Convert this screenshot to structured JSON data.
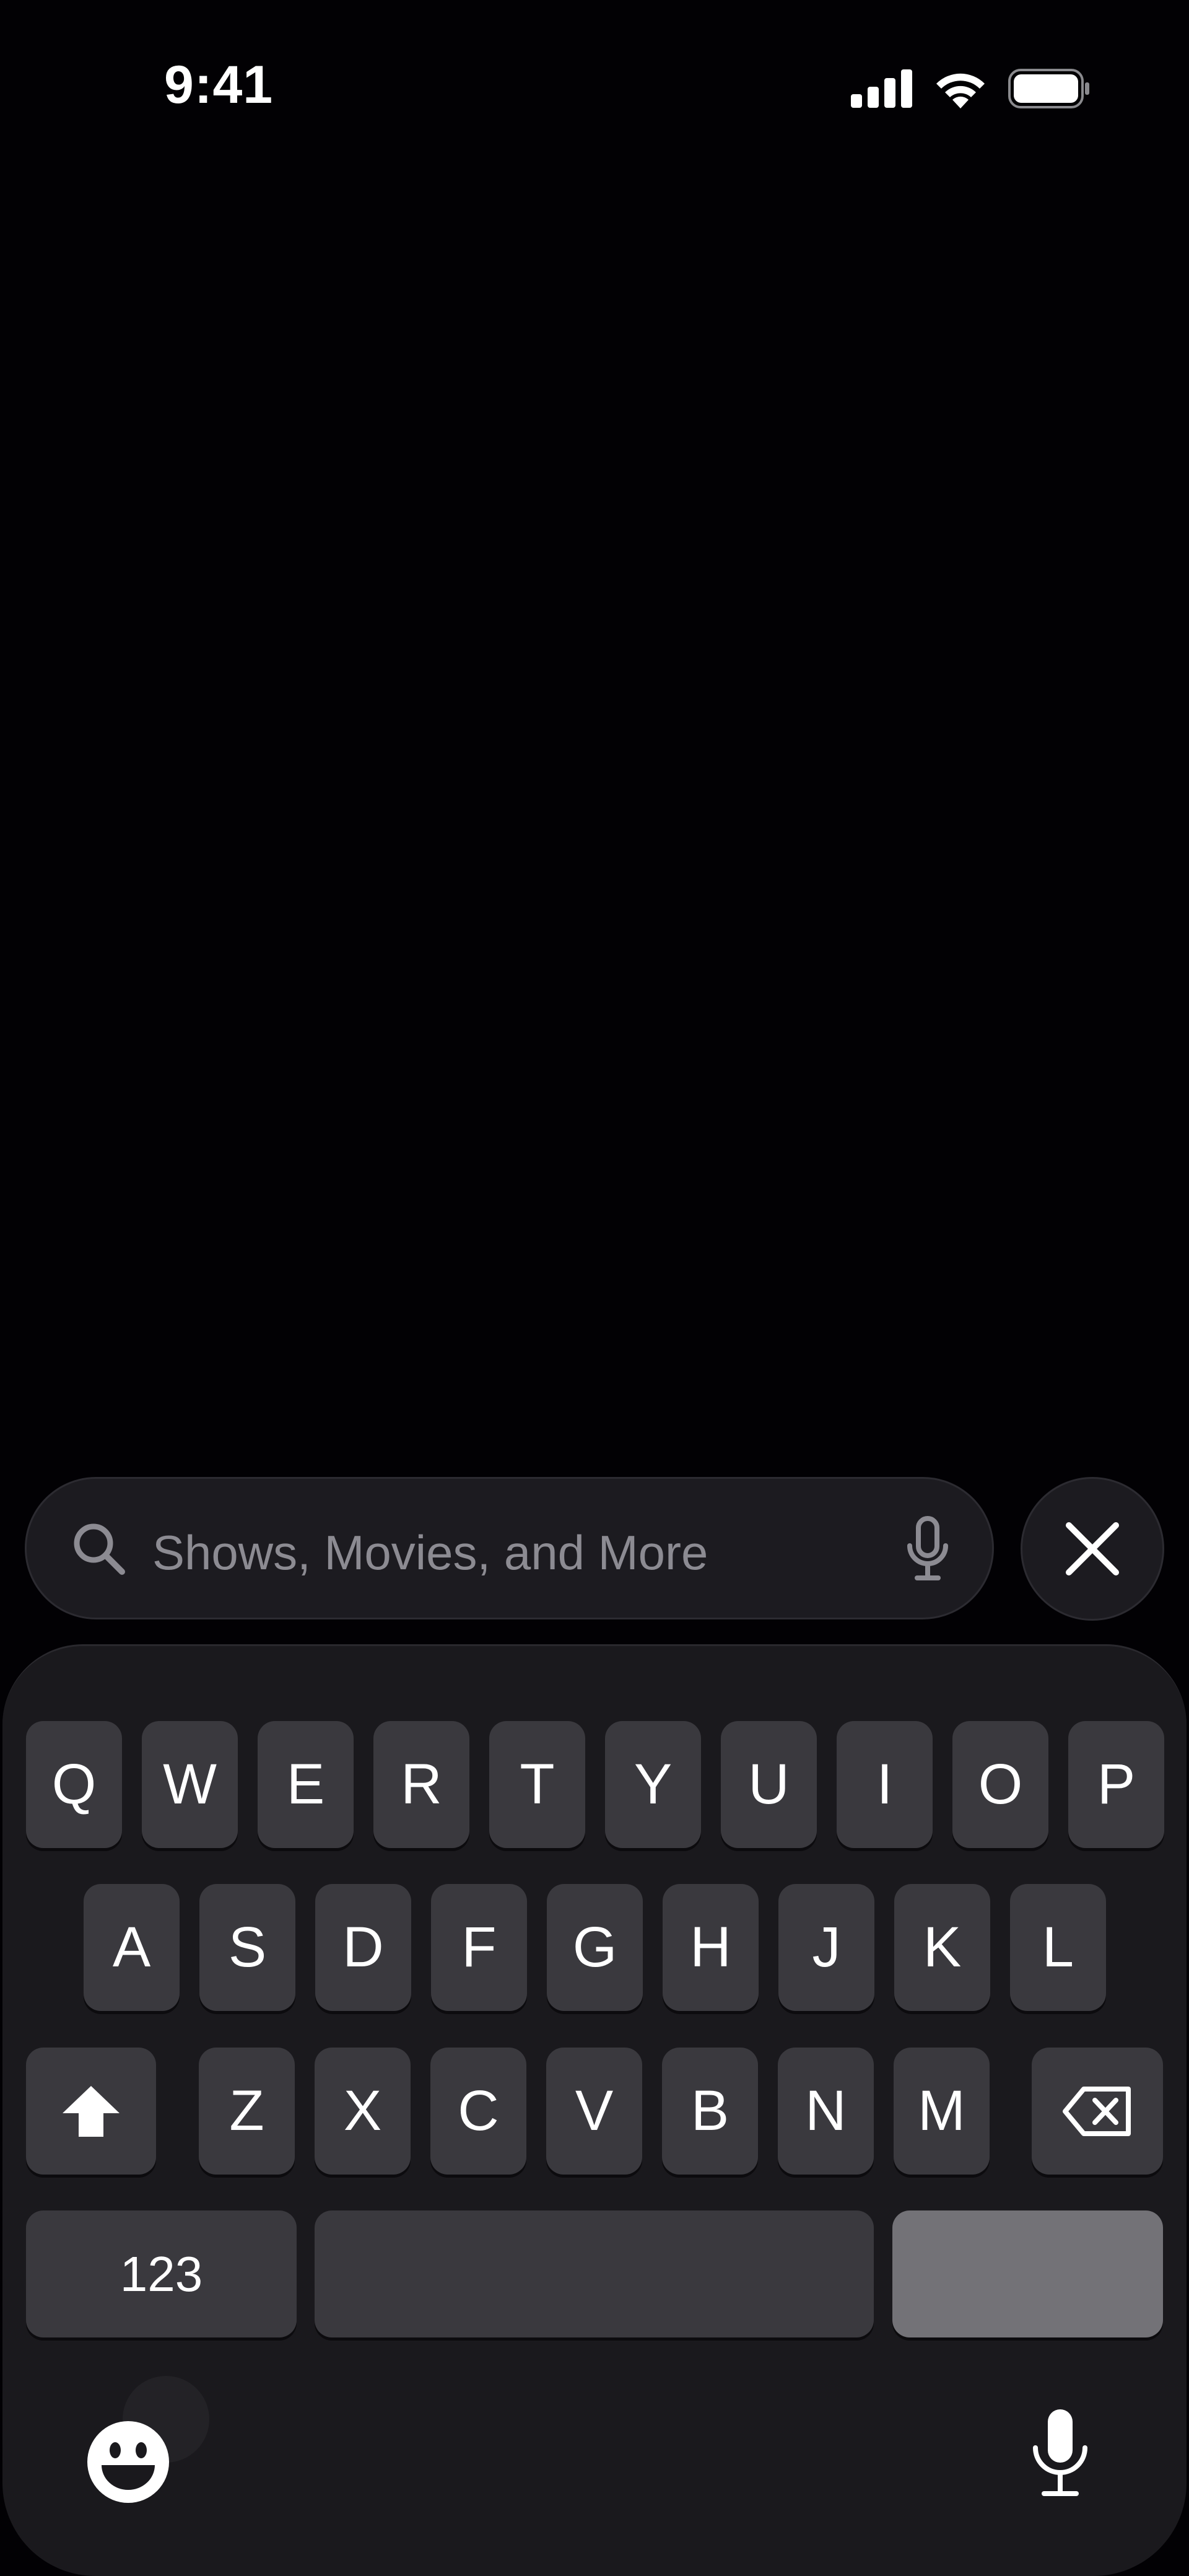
{
  "status_bar": {
    "time": "9:41",
    "icons": [
      "cellular-signal-icon",
      "wifi-icon",
      "battery-icon"
    ]
  },
  "search": {
    "placeholder": "Shows, Movies, and More",
    "icons": [
      "search-icon",
      "microphone-icon"
    ]
  },
  "close_button": {
    "icon": "close-icon"
  },
  "keyboard": {
    "row1": [
      "Q",
      "W",
      "E",
      "R",
      "T",
      "Y",
      "U",
      "I",
      "O",
      "P"
    ],
    "row2": [
      "A",
      "S",
      "D",
      "F",
      "G",
      "H",
      "J",
      "K",
      "L"
    ],
    "row3": [
      "Z",
      "X",
      "C",
      "V",
      "B",
      "N",
      "M"
    ],
    "numbers_label": "123",
    "space_label": "",
    "return_label": "",
    "icons": [
      "shift-icon",
      "delete-icon",
      "emoji-icon",
      "dictation-mic-icon"
    ]
  },
  "colors": {
    "background": "#020104",
    "key": "#3a393e",
    "return_key": "#737277",
    "keyboard_bg": "#1a191d",
    "placeholder": "#8c8b92"
  }
}
